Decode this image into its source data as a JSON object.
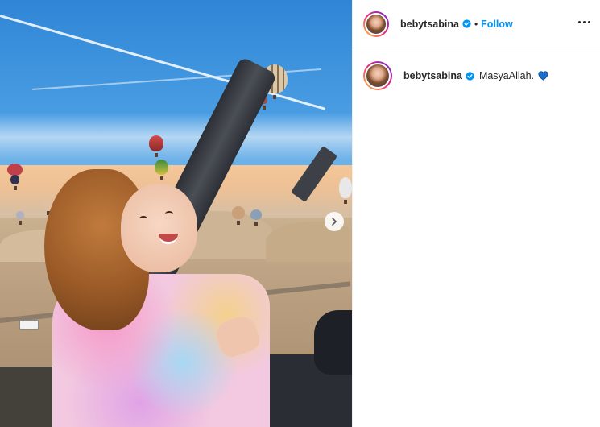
{
  "post": {
    "author": "bebytsabina",
    "verified": true,
    "dot": "•",
    "follow_label": "Follow",
    "caption": "MasyaAllah.",
    "caption_emoji": "blue-heart",
    "accent": "#0095f6"
  },
  "photo": {
    "next_icon": "chevron-right-icon"
  }
}
